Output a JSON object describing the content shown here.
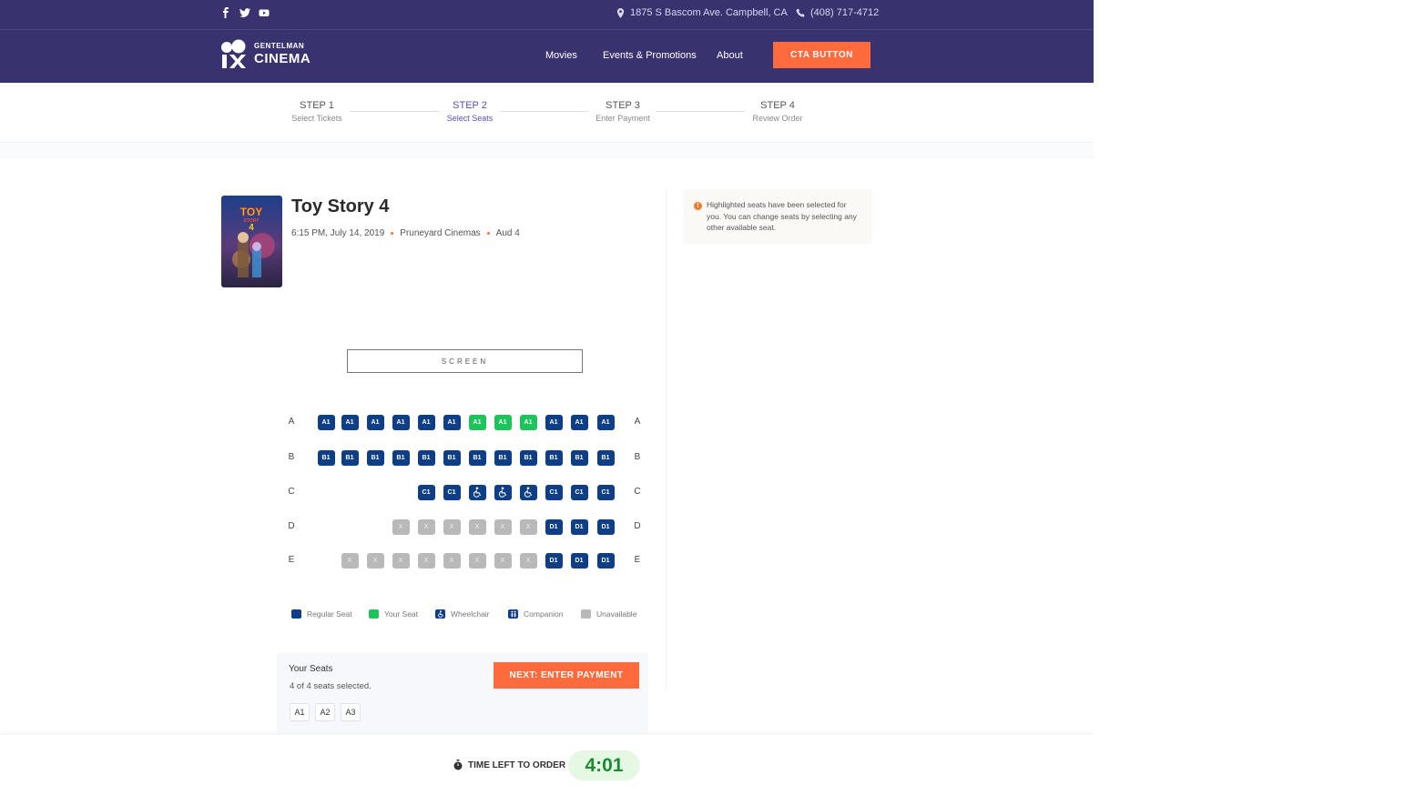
{
  "topbar": {
    "social_icons": [
      "facebook-icon",
      "twitter-icon",
      "youtube-icon"
    ],
    "address": "1875 S Bascom Ave. Campbell, CA",
    "phone": "(408) 717-4712"
  },
  "brand": {
    "line1": "GENTELMAN",
    "line2": "CINEMA"
  },
  "nav": {
    "links": [
      "Movies",
      "Events & Promotions",
      "About"
    ],
    "cta": "CTA BUTTON"
  },
  "steps": [
    {
      "title": "STEP 1",
      "subtitle": "Select Tickets",
      "active": false
    },
    {
      "title": "STEP 2",
      "subtitle": "Select Seats",
      "active": true
    },
    {
      "title": "STEP 3",
      "subtitle": "Enter Payment",
      "active": false
    },
    {
      "title": "STEP 4",
      "subtitle": "Review Order",
      "active": false
    }
  ],
  "movie": {
    "title": "Toy Story 4",
    "time": "6:15 PM, July 14, 2019",
    "theater": "Pruneyard Cinemas",
    "auditorium": "Aud 4"
  },
  "info": {
    "icon": "!",
    "text": "Highlighted seats have been selected for you. You can change seats by selecting any other available seat."
  },
  "screen_label": "SCREEN",
  "rows": [
    {
      "label": "A",
      "seats": [
        {
          "t": "regular",
          "l": "A1"
        },
        {
          "t": "regular",
          "l": "A1"
        },
        {
          "t": "regular",
          "l": "A1"
        },
        {
          "t": "regular",
          "l": "A1"
        },
        {
          "t": "regular",
          "l": "A1"
        },
        {
          "t": "regular",
          "l": "A1"
        },
        {
          "t": "mine",
          "l": "A1"
        },
        {
          "t": "mine",
          "l": "A1"
        },
        {
          "t": "mine",
          "l": "A1"
        },
        {
          "t": "regular",
          "l": "A1"
        },
        {
          "t": "regular",
          "l": "A1"
        },
        {
          "t": "regular",
          "l": "A1"
        }
      ]
    },
    {
      "label": "B",
      "seats": [
        {
          "t": "regular",
          "l": "B1"
        },
        {
          "t": "regular",
          "l": "B1"
        },
        {
          "t": "regular",
          "l": "B1"
        },
        {
          "t": "regular",
          "l": "B1"
        },
        {
          "t": "regular",
          "l": "B1"
        },
        {
          "t": "regular",
          "l": "B1"
        },
        {
          "t": "regular",
          "l": "B1"
        },
        {
          "t": "regular",
          "l": "B1"
        },
        {
          "t": "regular",
          "l": "B1"
        },
        {
          "t": "regular",
          "l": "B1"
        },
        {
          "t": "regular",
          "l": "B1"
        },
        {
          "t": "regular",
          "l": "B1"
        }
      ]
    },
    {
      "label": "C",
      "seats": [
        null,
        null,
        null,
        null,
        {
          "t": "regular",
          "l": "C1"
        },
        {
          "t": "regular",
          "l": "C1"
        },
        {
          "t": "wheel",
          "l": ""
        },
        {
          "t": "wheel",
          "l": ""
        },
        {
          "t": "wheel",
          "l": ""
        },
        {
          "t": "regular",
          "l": "C1"
        },
        {
          "t": "regular",
          "l": "C1"
        },
        {
          "t": "regular",
          "l": "C1"
        }
      ]
    },
    {
      "label": "D",
      "seats": [
        null,
        null,
        null,
        {
          "t": "unavail",
          "l": "X"
        },
        {
          "t": "unavail",
          "l": "X"
        },
        {
          "t": "unavail",
          "l": "X"
        },
        {
          "t": "unavail",
          "l": "X"
        },
        {
          "t": "unavail",
          "l": "X"
        },
        {
          "t": "unavail",
          "l": "X"
        },
        {
          "t": "regular",
          "l": "D1"
        },
        {
          "t": "regular",
          "l": "D1"
        },
        {
          "t": "regular",
          "l": "D1"
        }
      ]
    },
    {
      "label": "E",
      "seats": [
        null,
        {
          "t": "unavail",
          "l": "X"
        },
        {
          "t": "unavail",
          "l": "X"
        },
        {
          "t": "unavail",
          "l": "X"
        },
        {
          "t": "unavail",
          "l": "X"
        },
        {
          "t": "unavail",
          "l": "X"
        },
        {
          "t": "unavail",
          "l": "X"
        },
        {
          "t": "unavail",
          "l": "X"
        },
        {
          "t": "unavail",
          "l": "X"
        },
        {
          "t": "regular",
          "l": "D1"
        },
        {
          "t": "regular",
          "l": "D1"
        },
        {
          "t": "regular",
          "l": "D1"
        }
      ]
    }
  ],
  "legend": [
    {
      "label": "Regular Seat",
      "type": "regular"
    },
    {
      "label": "Your Seat",
      "type": "mine"
    },
    {
      "label": "Wheelchair",
      "type": "wheel"
    },
    {
      "label": "Companion",
      "type": "companion"
    },
    {
      "label": "Unavailable",
      "type": "unavail"
    }
  ],
  "your_seats": {
    "title": "Your Seats",
    "count_text": "4 of 4 seats selected.",
    "chips": [
      "A1",
      "A2",
      "A3"
    ],
    "next_button": "NEXT: ENTER PAYMENT"
  },
  "timer": {
    "label": "TIME LEFT TO ORDER",
    "value": "4:01"
  },
  "colors": {
    "header_bg": "#38336f",
    "accent": "#ff6b3d",
    "regular_seat": "#0e3f86",
    "your_seat": "#1fc35b",
    "unavailable_seat": "#b9b9b9"
  }
}
